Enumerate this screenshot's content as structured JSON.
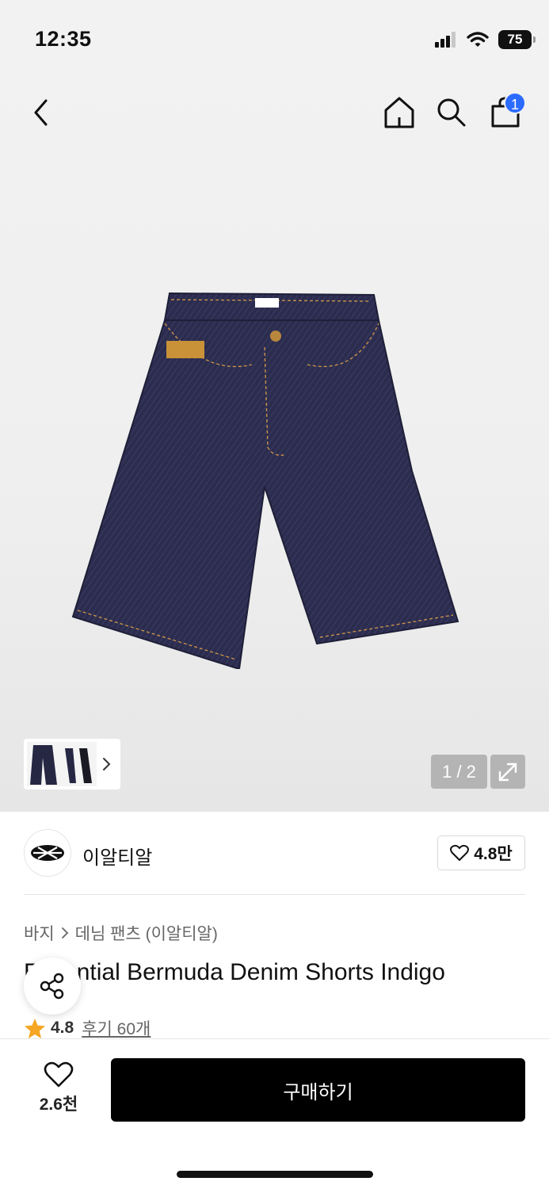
{
  "status_bar": {
    "time": "12:35",
    "battery": "75",
    "icons": [
      "signal-icon",
      "wifi-icon",
      "battery-icon"
    ]
  },
  "nav": {
    "icons": [
      "back-arrow-icon",
      "home-icon",
      "search-icon",
      "shopping-bag-icon"
    ],
    "cart_count": "1"
  },
  "gallery": {
    "page_indicator": "1 / 2",
    "image_subject": "indigo denim bermuda shorts"
  },
  "brand": {
    "name": "이알티알",
    "likes": "4.8만"
  },
  "breadcrumb": {
    "category": "바지",
    "subcategory": "데님 팬츠 (이알티알)"
  },
  "product": {
    "title": "Essential Bermuda Denim Shorts Indigo",
    "rating": "4.8",
    "reviews": "후기 60개"
  },
  "bottom_bar": {
    "wish_count": "2.6천",
    "buy_label": "구매하기"
  },
  "colors": {
    "badge": "#2b6bff",
    "star": "#f5a623",
    "buy_button": "#000000"
  }
}
